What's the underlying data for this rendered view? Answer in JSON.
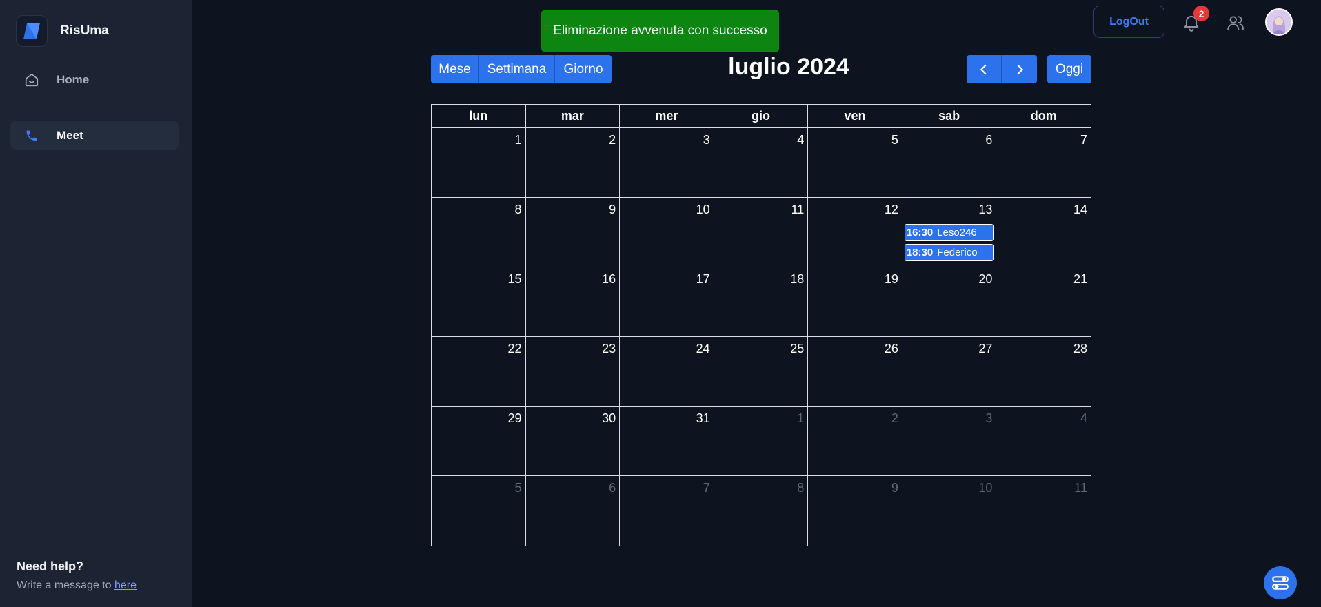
{
  "sidebar": {
    "brand_name": "RisUma",
    "items": [
      {
        "label": "Home",
        "icon": "home-icon"
      },
      {
        "label": "Meet",
        "icon": "phone-icon"
      }
    ],
    "help_title": "Need help?",
    "help_text": "Write a message to",
    "help_link": "here"
  },
  "toast": {
    "message": "Eliminazione avvenuta con successo",
    "color": "#0c8511"
  },
  "header": {
    "logout_label": "LogOut",
    "notification_count": "2",
    "icons": [
      "bell-icon",
      "people-icon",
      "avatar"
    ]
  },
  "calendar": {
    "views": [
      "Mese",
      "Settimana",
      "Giorno"
    ],
    "title": "luglio 2024",
    "prev_icon": "chevron-left-icon",
    "next_icon": "chevron-right-icon",
    "today_label": "Oggi",
    "weekdays": [
      "lun",
      "mar",
      "mer",
      "gio",
      "ven",
      "sab",
      "dom"
    ],
    "days": [
      {
        "n": "1",
        "cur": true
      },
      {
        "n": "2",
        "cur": true
      },
      {
        "n": "3",
        "cur": true
      },
      {
        "n": "4",
        "cur": true
      },
      {
        "n": "5",
        "cur": true
      },
      {
        "n": "6",
        "cur": true
      },
      {
        "n": "7",
        "cur": true
      },
      {
        "n": "8",
        "cur": true
      },
      {
        "n": "9",
        "cur": true
      },
      {
        "n": "10",
        "cur": true
      },
      {
        "n": "11",
        "cur": true
      },
      {
        "n": "12",
        "cur": true
      },
      {
        "n": "13",
        "cur": true,
        "events": [
          {
            "time": "16:30",
            "title": "Leso246"
          },
          {
            "time": "18:30",
            "title": "Federico"
          }
        ]
      },
      {
        "n": "14",
        "cur": true
      },
      {
        "n": "15",
        "cur": true
      },
      {
        "n": "16",
        "cur": true
      },
      {
        "n": "17",
        "cur": true
      },
      {
        "n": "18",
        "cur": true
      },
      {
        "n": "19",
        "cur": true
      },
      {
        "n": "20",
        "cur": true
      },
      {
        "n": "21",
        "cur": true
      },
      {
        "n": "22",
        "cur": true
      },
      {
        "n": "23",
        "cur": true
      },
      {
        "n": "24",
        "cur": true
      },
      {
        "n": "25",
        "cur": true
      },
      {
        "n": "26",
        "cur": true
      },
      {
        "n": "27",
        "cur": true
      },
      {
        "n": "28",
        "cur": true
      },
      {
        "n": "29",
        "cur": true
      },
      {
        "n": "30",
        "cur": true
      },
      {
        "n": "31",
        "cur": true
      },
      {
        "n": "1",
        "cur": false
      },
      {
        "n": "2",
        "cur": false
      },
      {
        "n": "3",
        "cur": false
      },
      {
        "n": "4",
        "cur": false
      },
      {
        "n": "5",
        "cur": false
      },
      {
        "n": "6",
        "cur": false
      },
      {
        "n": "7",
        "cur": false
      },
      {
        "n": "8",
        "cur": false
      },
      {
        "n": "9",
        "cur": false
      },
      {
        "n": "10",
        "cur": false
      },
      {
        "n": "11",
        "cur": false
      }
    ]
  },
  "fab": {
    "icon": "settings-toggle-icon"
  },
  "colors": {
    "accent": "#2c72ec",
    "background": "#0e1320",
    "sidebar": "#1c2434",
    "badge": "#e5383b"
  }
}
